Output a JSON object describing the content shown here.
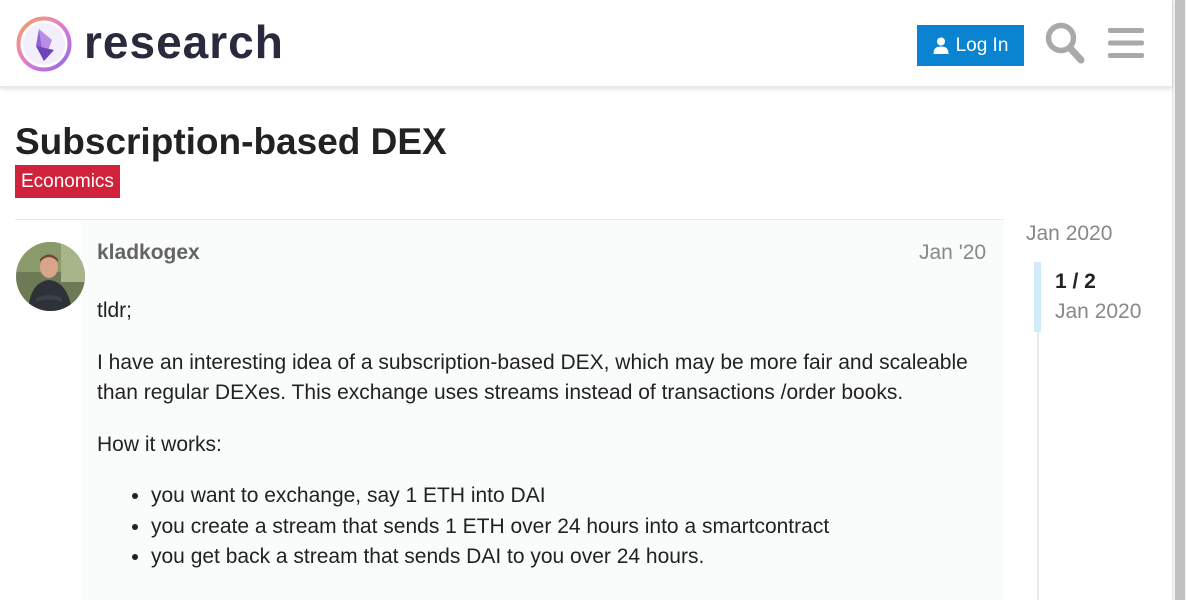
{
  "header": {
    "brand": "research",
    "login_label": "Log In",
    "icons": [
      "ethereum-logo",
      "user-icon",
      "search-icon",
      "hamburger-menu-icon"
    ]
  },
  "topic": {
    "title": "Subscription-based DEX",
    "category": "Economics",
    "category_color": "#d0233b"
  },
  "post": {
    "username": "kladkogex",
    "date": "Jan '20",
    "paragraphs": [
      "tldr;",
      "I have an interesting idea of a subscription-based DEX, which may be more fair and scaleable than regular DEXes. This exchange uses streams instead of transactions /order books.",
      "How it works:"
    ],
    "bullets": [
      "you want to exchange, say 1 ETH into DAI",
      "you create a stream that sends 1 ETH over 24 hours into a smartcontract",
      "you get back a stream that sends DAI to you over 24 hours."
    ]
  },
  "timeline": {
    "start": "Jan 2020",
    "position": "1 / 2",
    "position_date": "Jan 2020"
  },
  "colors": {
    "accent": "#0a84d0",
    "timeline_handle": "#d1ebf9"
  }
}
